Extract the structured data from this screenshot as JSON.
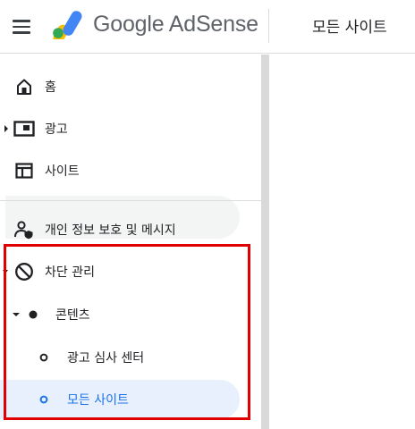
{
  "header": {
    "brand_name": "Google AdSense",
    "page_title": "모든 사이트"
  },
  "sidebar": {
    "items": [
      {
        "label": "홈",
        "icon": "home-icon"
      },
      {
        "label": "광고",
        "icon": "ads-icon"
      },
      {
        "label": "사이트",
        "icon": "sites-icon"
      },
      {
        "label": "개인 정보 보호 및 메시지",
        "icon": "privacy-messaging-icon"
      },
      {
        "label": "차단 관리",
        "icon": "block-icon"
      },
      {
        "label": "콘텐츠",
        "icon": "filled-dot-icon"
      },
      {
        "label": "광고 심사 센터",
        "icon": "hollow-dot-icon"
      },
      {
        "label": "모든 사이트",
        "icon": "hollow-dot-icon"
      }
    ]
  },
  "colors": {
    "highlight_border": "#e00000",
    "selected_background": "#e8f0fe",
    "selected_icon": "#1a73e8",
    "logo_blue": "#4285f4",
    "logo_yellow": "#fbbc04",
    "logo_green": "#34a853"
  }
}
